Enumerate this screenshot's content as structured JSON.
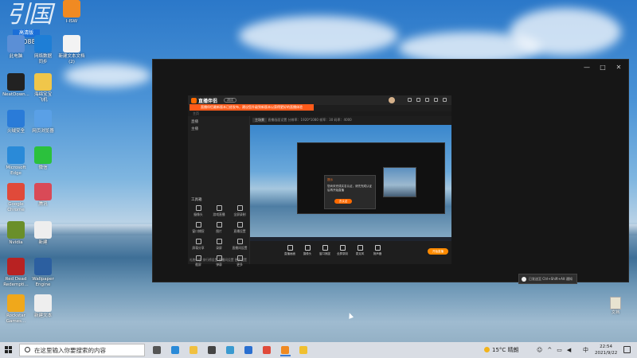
{
  "desktop": {
    "watermark": {
      "badge": "高清版",
      "number": "7130886"
    },
    "icons": [
      {
        "label": "此电脑",
        "color": "#5b8fd6"
      },
      {
        "label": "网络数据\n同步",
        "color": "#1e7ed6"
      },
      {
        "label": "新建文本文档\n(2)",
        "color": "#f3f3f3"
      },
      {
        "label": "NeatDown...",
        "color": "#222222"
      },
      {
        "label": "海绵宝宝\n飞机",
        "color": "#f0c64a"
      },
      {
        "label": "火绒安全",
        "color": "#2a7bd8"
      },
      {
        "label": "网页浏览器",
        "color": "#5aa0e6"
      },
      {
        "label": "Microsoft\nEdge",
        "color": "#2a8ad8"
      },
      {
        "label": "微信",
        "color": "#2bc13d"
      },
      {
        "label": "Google\nChrome",
        "color": "#e04a3a"
      },
      {
        "label": "腾讯",
        "color": "#d94a57"
      },
      {
        "label": "Nvidia",
        "color": "#6a8f2a"
      },
      {
        "label": "新建",
        "color": "#eeeeee"
      },
      {
        "label": "Red Dead\nRedempti...",
        "color": "#b82222"
      },
      {
        "label": "Wallpaper\nEngine",
        "color": "#2c5fa0"
      },
      {
        "label": "Rockstar\nGames...",
        "color": "#f0a81b"
      },
      {
        "label": "新建文本",
        "color": "#eeeeee"
      },
      {
        "label": "I-ISW",
        "color": "#f08a22"
      }
    ],
    "recycle_label": "文档",
    "toast": "已发送至 Ctrl+Shift+Alt 通知"
  },
  "window": {
    "controls": [
      "—",
      "□",
      "✕"
    ]
  },
  "app": {
    "name": "直播伴侣",
    "badge": "测试",
    "banner": "直播伴侣最新版本已经发布，建议您升级到新版本以获得更好的直播体验",
    "subbar": "主页",
    "side": {
      "rows": [
        "直播",
        "主播"
      ],
      "section": "工具箱",
      "tools": [
        "摄像头",
        "游戏直播",
        "全屏录制",
        "窗口捕捉",
        "图片",
        "直播设置",
        "屏幕分享",
        "录屏",
        "直播间设置",
        "截屏",
        "弹幕",
        "更多"
      ],
      "bottom": "礼物公告  排行榜设置  直播间设置  更多设置"
    },
    "toolbar_chip": "主场景",
    "toolbar_text": "直播画面设置   分辨率：1920*1080   帧率：30   码率：4000",
    "dialog": {
      "title": "提示",
      "message": "您尚未完成实名认证，请先完成认证后再开始直播",
      "button": "去认证"
    },
    "controls": [
      "直播画面",
      "摄像头",
      "窗口捕捉",
      "全屏录制",
      "麦克风",
      "扬声器"
    ],
    "live_button": "开始直播"
  },
  "taskbar": {
    "search_placeholder": "在这里输入你要搜索的内容",
    "apps": [
      {
        "name": "task-view",
        "color": "#555555"
      },
      {
        "name": "edge",
        "color": "#2a8ad8"
      },
      {
        "name": "explorer",
        "color": "#f0c040"
      },
      {
        "name": "store",
        "color": "#444444"
      },
      {
        "name": "edge-beta",
        "color": "#3a9ad0"
      },
      {
        "name": "mail",
        "color": "#2a6fd0"
      },
      {
        "name": "chrome",
        "color": "#e04a3a"
      },
      {
        "name": "app-orange",
        "color": "#f08a22"
      },
      {
        "name": "app-yellow",
        "color": "#f0c030"
      }
    ],
    "weather": "15°C 晴朗",
    "ime": "中",
    "time": "22:54",
    "date": "2021/9/22"
  }
}
